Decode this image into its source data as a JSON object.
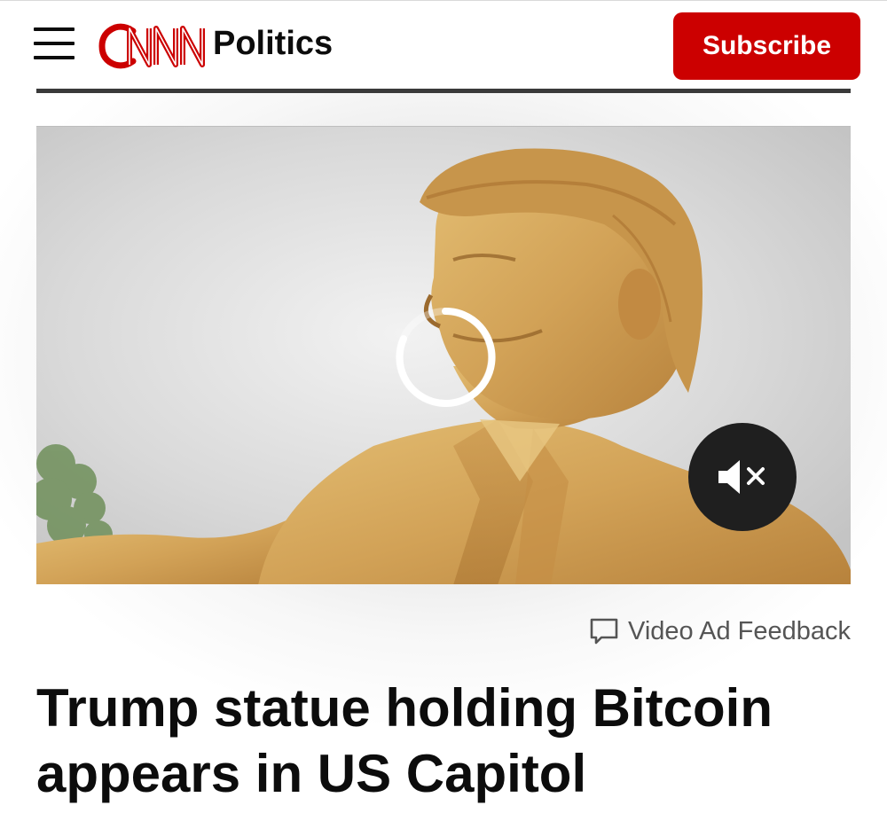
{
  "header": {
    "brand": "CNN",
    "section": "Politics",
    "subscribe_label": "Subscribe"
  },
  "icons": {
    "menu": "hamburger-menu-icon",
    "mute": "speaker-muted-icon",
    "loading": "loading-spinner-icon",
    "feedback": "speech-bubble-icon"
  },
  "video": {
    "state": "loading",
    "muted": true
  },
  "feedback_label": "Video Ad Feedback",
  "headline": "Trump statue holding Bitcoin appears in US Capitol",
  "colors": {
    "brand_red": "#cc0000",
    "text": "#0c0c0c",
    "muted_text": "#555555",
    "statue_gold": "#d4a95a"
  }
}
